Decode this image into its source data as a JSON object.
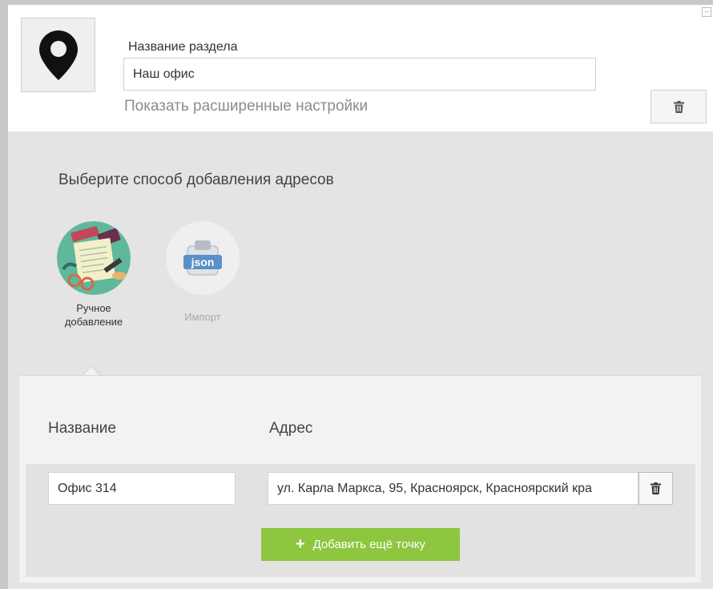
{
  "header": {
    "section_label": "Название раздела",
    "section_name_value": "Наш офис",
    "advanced_link": "Показать расширенные настройки"
  },
  "method_selector": {
    "title": "Выберите способ добавления адресов",
    "options": [
      {
        "label": "Ручное добавление",
        "active": true
      },
      {
        "label": "Импорт",
        "active": false,
        "badge": "json"
      }
    ]
  },
  "addresses": {
    "columns": {
      "name": "Название",
      "address": "Адрес"
    },
    "rows": [
      {
        "name": "Офис 314",
        "address": "ул. Карла Маркса, 95, Красноярск, Красноярский кра"
      }
    ],
    "add_button": "Добавить ещё точку"
  },
  "colors": {
    "accent_green": "#8dc63f",
    "panel_bg": "#e4e4e4",
    "muted_text": "#8c8c8c"
  }
}
